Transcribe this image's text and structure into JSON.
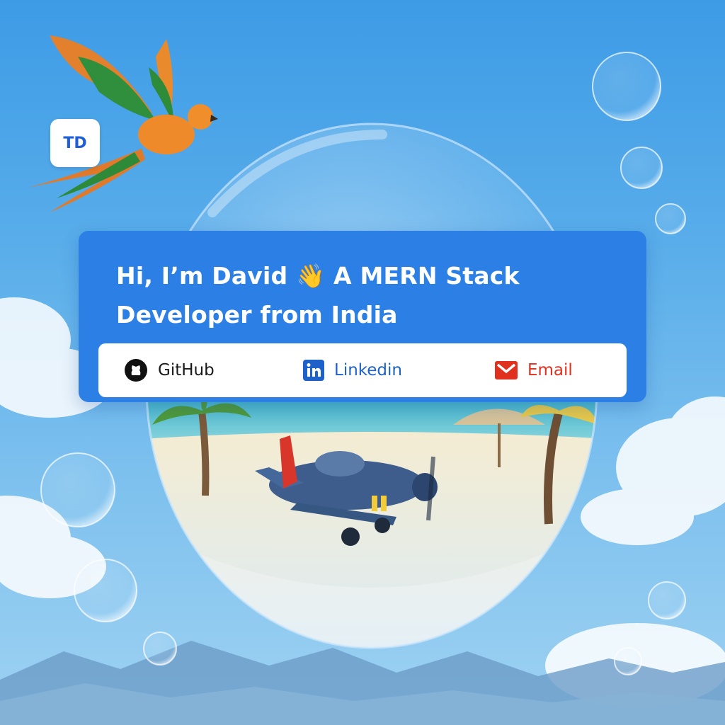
{
  "brand": {
    "logo_text": "TD"
  },
  "hero": {
    "headline_line1": "Hi, I’m David 👋 A MERN Stack",
    "headline_line2": "Developer from India"
  },
  "links": [
    {
      "label": "GitHub",
      "icon": "github-icon"
    },
    {
      "label": "Linkedin",
      "icon": "linkedin-icon"
    },
    {
      "label": "Email",
      "icon": "email-icon"
    }
  ],
  "colors": {
    "sky": "#3d9be6",
    "card": "#2b7fe5",
    "github": "#1a1a1a",
    "linkedin": "#1d61c9",
    "email": "#e0301e"
  }
}
